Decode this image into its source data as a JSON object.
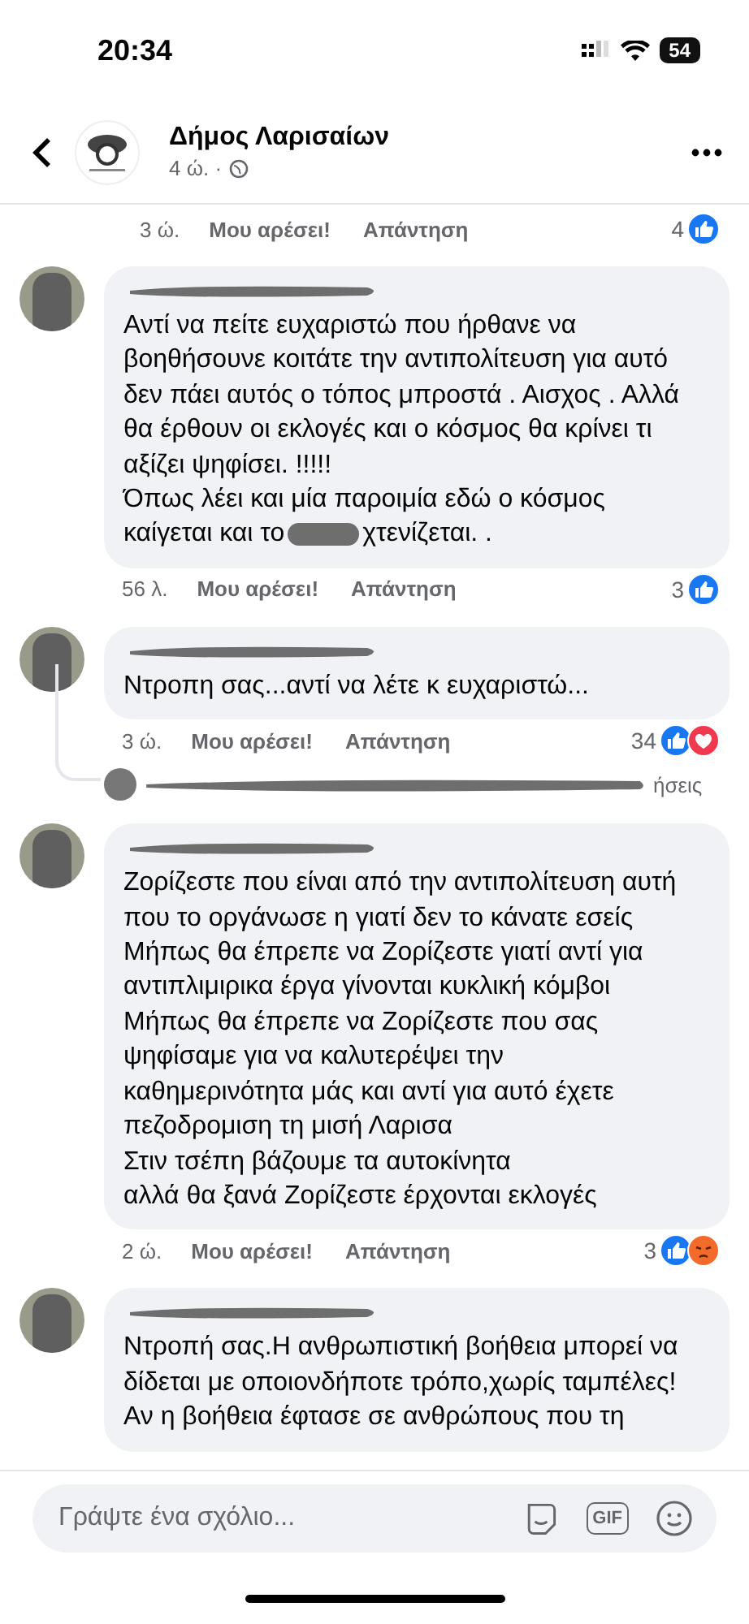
{
  "status_bar": {
    "time": "20:34",
    "battery": "54"
  },
  "header": {
    "title": "Δήμος Λαρισαίων",
    "meta": "4 ώ. ·"
  },
  "top_footer": {
    "time": "3 ώ.",
    "like": "Μου αρέσει!",
    "reply": "Απάντηση",
    "count": "4",
    "reactions": [
      {
        "kind": "like"
      }
    ]
  },
  "comments": [
    {
      "lines": [
        "Αντί να πείτε ευχαριστώ που ήρθανε να",
        "βοηθήσουνε κοιτάτε την αντιπολίτευση για αυτό",
        "δεν πάει αυτός ο τόπος μπροστά . Αισχος . Αλλά",
        "θα έρθουν οι εκλογές και ο κόσμος θα κρίνει τι",
        "αξίζει ψηφίσει. !!!!!",
        "Όπως λέει και μία παροιμία εδώ ο κόσμος",
        {
          "parts": [
            "καίγεται και το",
            "χτενίζεται. ."
          ]
        }
      ],
      "footer": {
        "time": "56 λ.",
        "like": "Μου αρέσει!",
        "reply": "Απάντηση",
        "count": "3",
        "reactions": [
          {
            "kind": "like"
          }
        ]
      }
    },
    {
      "lines": [
        "Ντροπη σας...αντί να λέτε κ ευχαριστώ..."
      ],
      "footer": {
        "time": "3 ώ.",
        "like": "Μου αρέσει!",
        "reply": "Απάντηση",
        "count": "34",
        "reactions": [
          {
            "kind": "like"
          },
          {
            "kind": "love"
          }
        ]
      },
      "replies_tail": "ήσεις"
    },
    {
      "lines": [
        "Ζορίζεστε που είναι από την αντιπολίτευση αυτή",
        "που το οργάνωσε η γιατί δεν το κάνατε εσείς",
        "Μήπως θα έπρεπε να Ζορίζεστε γιατί αντί για",
        "αντιπλιμιρικα έργα γίνονται κυκλική κόμβοι",
        "Μήπως θα έπρεπε να Ζορίζεστε που σας",
        "ψηφίσαμε για να καλυτερέψει την",
        "καθημερινότητα μάς και αντί για αυτό έχετε",
        "πεζοδρομιση τη μισή Λαρισα",
        "Στιν τσέπη βάζουμε τα αυτοκίνητα",
        "αλλά θα ξανά Ζορίζεστε έρχονται εκλογές"
      ],
      "footer": {
        "time": "2 ώ.",
        "like": "Μου αρέσει!",
        "reply": "Απάντηση",
        "count": "3",
        "reactions": [
          {
            "kind": "like"
          },
          {
            "kind": "angry"
          }
        ]
      }
    },
    {
      "lines": [
        "Ντροπή σας.Η ανθρωπιστική βοήθεια μπορεί να",
        "δίδεται με οποιονδήποτε τρόπο,χωρίς ταμπέλες!",
        "Αν η βοήθεια έφτασε σε ανθρώπους που τη"
      ]
    }
  ],
  "composer": {
    "placeholder": "Γράψτε ένα σχόλιο...",
    "gif": "GIF"
  }
}
